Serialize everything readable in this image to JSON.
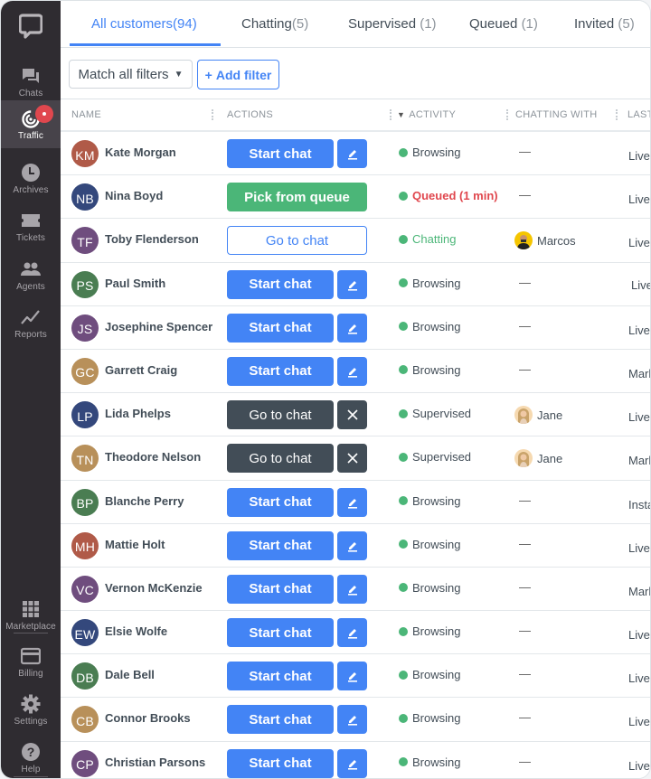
{
  "sidebar": {
    "logo": "chat-logo-icon",
    "items": [
      {
        "id": "chats",
        "label": "Chats",
        "icon": "chats-icon",
        "active": false
      },
      {
        "id": "traffic",
        "label": "Traffic",
        "icon": "traffic-icon",
        "active": true,
        "badge": true
      },
      {
        "id": "archives",
        "label": "Archives",
        "icon": "clock-icon",
        "active": false
      },
      {
        "id": "tickets",
        "label": "Tickets",
        "icon": "ticket-icon",
        "active": false
      },
      {
        "id": "agents",
        "label": "Agents",
        "icon": "agents-icon",
        "active": false
      },
      {
        "id": "reports",
        "label": "Reports",
        "icon": "chart-line-icon",
        "active": false
      }
    ],
    "bottom_items": [
      {
        "id": "marketplace",
        "label": "Marketplace",
        "icon": "grid-icon"
      },
      {
        "id": "billing",
        "label": "Billing",
        "icon": "credit-card-icon"
      },
      {
        "id": "settings",
        "label": "Settings",
        "icon": "gear-icon"
      },
      {
        "id": "help",
        "label": "Help",
        "icon": "help-icon"
      }
    ]
  },
  "tabs": [
    {
      "label": "All customers",
      "count": "(94)",
      "active": true
    },
    {
      "label": "Chatting",
      "count": "(5)",
      "active": false
    },
    {
      "label": "Supervised",
      "count": "(1)",
      "active": false
    },
    {
      "label": "Queued",
      "count": "(1)",
      "active": false
    },
    {
      "label": "Invited",
      "count": "(5)",
      "active": false
    }
  ],
  "filters": {
    "match_label": "Match all filters",
    "add_filter_label": "Add filter",
    "add_prefix": "+"
  },
  "table": {
    "columns": [
      "Name",
      "Actions",
      "Activity",
      "Chatting with",
      "Last"
    ],
    "sorted_column": "Activity",
    "rows": [
      {
        "initials": "KM",
        "name": "Kate Morgan",
        "avatar_color": "#b05a48",
        "action": "Start chat",
        "action_type": "start",
        "side": "edit",
        "activity": "Browsing",
        "activity_type": "browsing",
        "chatting_with": "—",
        "agent": null,
        "last": "LiveC",
        "cursor": true
      },
      {
        "initials": "NB",
        "name": "Nina Boyd",
        "avatar_color": "#34487c",
        "action": "Pick from queue",
        "action_type": "queue",
        "side": null,
        "activity": "Queued (1 min)",
        "activity_type": "queued",
        "chatting_with": "—",
        "agent": null,
        "last": "LiveC"
      },
      {
        "initials": "TF",
        "name": "Toby Flenderson",
        "avatar_color": "#6f4d7e",
        "action": "Go to chat",
        "action_type": "goto-outline",
        "side": null,
        "activity": "Chatting",
        "activity_type": "chatting",
        "chatting_with": "Marcos",
        "agent": "marcos",
        "last": "LiveC"
      },
      {
        "initials": "PS",
        "name": "Paul Smith",
        "avatar_color": "#4a7d52",
        "action": "Start chat",
        "action_type": "start",
        "side": "edit",
        "activity": "Browsing",
        "activity_type": "browsing",
        "chatting_with": "—",
        "agent": null,
        "last": "Live",
        "indent": true
      },
      {
        "initials": "JS",
        "name": "Josephine Spencer",
        "avatar_color": "#6f4d7e",
        "action": "Start chat",
        "action_type": "start",
        "side": "edit",
        "activity": "Browsing",
        "activity_type": "browsing",
        "chatting_with": "—",
        "agent": null,
        "last": "LiveC"
      },
      {
        "initials": "GC",
        "name": "Garrett Craig",
        "avatar_color": "#b8905a",
        "action": "Start chat",
        "action_type": "start",
        "side": "edit",
        "activity": "Browsing",
        "activity_type": "browsing",
        "chatting_with": "—",
        "agent": null,
        "last": "Mark"
      },
      {
        "initials": "LP",
        "name": "Lida Phelps",
        "avatar_color": "#34487c",
        "action": "Go to chat",
        "action_type": "goto-dark",
        "side": "close",
        "activity": "Supervised",
        "activity_type": "supervised",
        "chatting_with": "Jane",
        "agent": "jane",
        "last": "LiveC"
      },
      {
        "initials": "TN",
        "name": "Theodore Nelson",
        "avatar_color": "#b8905a",
        "action": "Go to chat",
        "action_type": "goto-dark",
        "side": "close",
        "activity": "Supervised",
        "activity_type": "supervised",
        "chatting_with": "Jane",
        "agent": "jane",
        "last": "Mark"
      },
      {
        "initials": "BP",
        "name": "Blanche Perry",
        "avatar_color": "#4a7d52",
        "action": "Start chat",
        "action_type": "start",
        "side": "edit",
        "activity": "Browsing",
        "activity_type": "browsing",
        "chatting_with": "—",
        "agent": null,
        "last": "Insta",
        "cursor": true
      },
      {
        "initials": "MH",
        "name": "Mattie Holt",
        "avatar_color": "#b05a48",
        "action": "Start chat",
        "action_type": "start",
        "side": "edit",
        "activity": "Browsing",
        "activity_type": "browsing",
        "chatting_with": "—",
        "agent": null,
        "last": "LiveC"
      },
      {
        "initials": "VC",
        "name": "Vernon McKenzie",
        "avatar_color": "#6f4d7e",
        "action": "Start chat",
        "action_type": "start",
        "side": "edit",
        "activity": "Browsing",
        "activity_type": "browsing",
        "chatting_with": "—",
        "agent": null,
        "last": "Mark"
      },
      {
        "initials": "EW",
        "name": "Elsie Wolfe",
        "avatar_color": "#34487c",
        "action": "Start chat",
        "action_type": "start",
        "side": "edit",
        "activity": "Browsing",
        "activity_type": "browsing",
        "chatting_with": "—",
        "agent": null,
        "last": "LiveC"
      },
      {
        "initials": "DB",
        "name": "Dale Bell",
        "avatar_color": "#4a7d52",
        "action": "Start chat",
        "action_type": "start",
        "side": "edit",
        "activity": "Browsing",
        "activity_type": "browsing",
        "chatting_with": "—",
        "agent": null,
        "last": "LiveC"
      },
      {
        "initials": "CB",
        "name": "Connor Brooks",
        "avatar_color": "#b8905a",
        "action": "Start chat",
        "action_type": "start",
        "side": "edit",
        "activity": "Browsing",
        "activity_type": "browsing",
        "chatting_with": "—",
        "agent": null,
        "last": "LiveC"
      },
      {
        "initials": "CP",
        "name": "Christian Parsons",
        "avatar_color": "#6f4d7e",
        "action": "Start chat",
        "action_type": "start",
        "side": "edit",
        "activity": "Browsing",
        "activity_type": "browsing",
        "chatting_with": "—",
        "agent": null,
        "last": "LiveC"
      }
    ]
  },
  "colors": {
    "accent": "#4384f5",
    "success": "#4bb678",
    "danger": "#e0474e",
    "dark": "#424d57",
    "sidebar_bg": "#2f2c31"
  }
}
